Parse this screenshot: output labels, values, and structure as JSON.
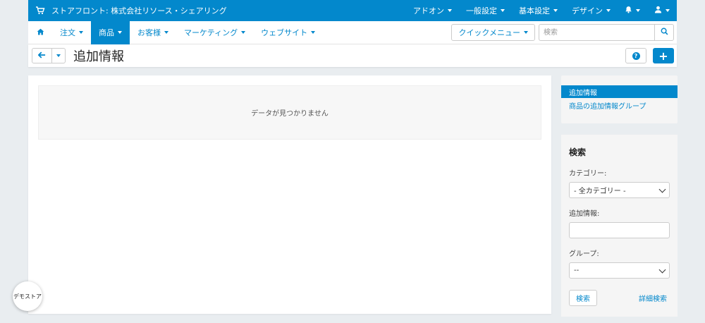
{
  "topbar": {
    "store_title": "ストアフロント: 株式会社リソース・シェアリング",
    "menu": [
      {
        "label": "アドオン"
      },
      {
        "label": "一般設定"
      },
      {
        "label": "基本設定"
      },
      {
        "label": "デザイン"
      }
    ]
  },
  "nav": {
    "items": [
      {
        "label": "注文"
      },
      {
        "label": "商品"
      },
      {
        "label": "お客様"
      },
      {
        "label": "マーケティング"
      },
      {
        "label": "ウェブサイト"
      }
    ],
    "quick_menu": "クイックメニュー",
    "search_placeholder": "検索"
  },
  "page": {
    "title": "追加情報",
    "empty_message": "データが見つかりません"
  },
  "sidebar": {
    "links": [
      {
        "label": "追加情報"
      },
      {
        "label": "商品の追加情報グループ"
      }
    ],
    "search": {
      "title": "検索",
      "category_label": "カテゴリー:",
      "category_value": "- 全カテゴリー -",
      "extra_label": "追加情報:",
      "extra_value": "",
      "group_label": "グループ:",
      "group_value": "--",
      "search_button": "検索",
      "advanced_link": "詳細検索"
    }
  },
  "demo_store": "デモストア",
  "colors": {
    "accent": "#0388cc",
    "background": "#e9edf0"
  }
}
